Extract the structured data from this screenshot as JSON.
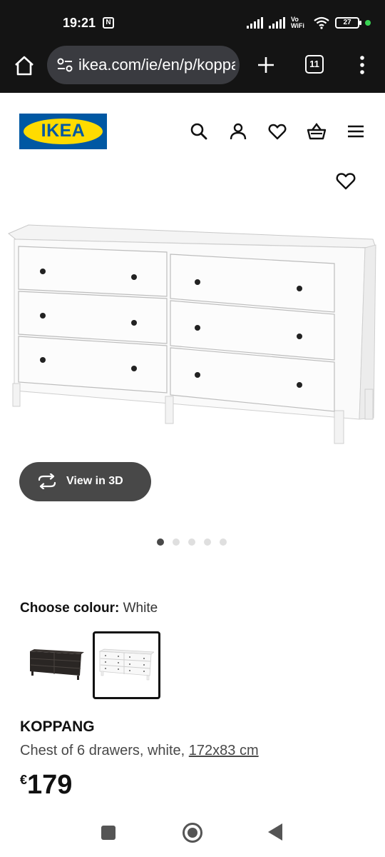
{
  "status_bar": {
    "time": "19:21",
    "nfc_glyph": "N",
    "network_label": "Vo WiFi",
    "battery": "27",
    "icons": [
      "nfc-icon",
      "signal-icon",
      "volte-wifi-icon",
      "wifi-icon",
      "battery-icon"
    ]
  },
  "browser": {
    "url": "ikea.com/ie/en/p/koppang",
    "tab_count": "11",
    "icons": [
      "home-icon",
      "site-settings-icon",
      "new-tab-icon",
      "tabs-icon",
      "more-icon"
    ]
  },
  "header": {
    "logo_text": "IKEA",
    "brand_colors": {
      "blue": "#0058a3",
      "yellow": "#ffdb00"
    },
    "icons": [
      "search-icon",
      "account-icon",
      "favourites-icon",
      "basket-icon",
      "hamburger-icon"
    ]
  },
  "gallery": {
    "view3d_label": "View in 3D",
    "slide_count": 5,
    "active_slide": 1
  },
  "colour": {
    "label": "Choose colour:",
    "value": "White",
    "swatches": [
      {
        "name": "black-brown",
        "selected": false
      },
      {
        "name": "white",
        "selected": true
      }
    ]
  },
  "product": {
    "name": "KOPPANG",
    "description": "Chest of 6 drawers, white, ",
    "dimensions": "172x83 cm",
    "currency": "€",
    "price": "179"
  }
}
